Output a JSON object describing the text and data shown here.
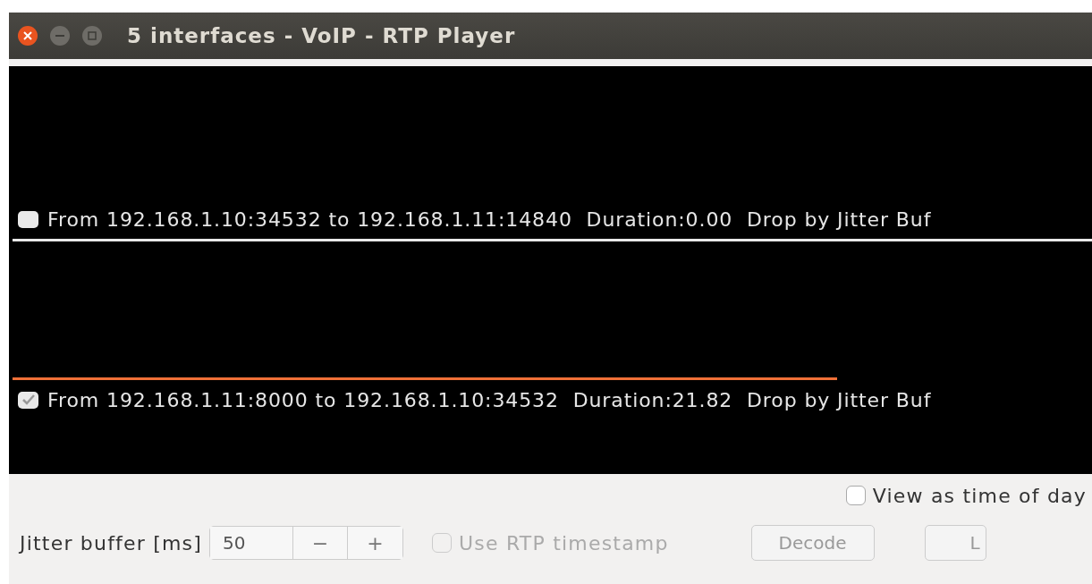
{
  "window": {
    "title": "5 interfaces - VoIP - RTP Player"
  },
  "streams": [
    {
      "checked": false,
      "label": "From 192.168.1.10:34532 to 192.168.1.11:14840",
      "duration": "Duration:0.00",
      "drop": "Drop by Jitter Buf",
      "color": "#e8e8e8",
      "level": 1
    },
    {
      "checked": true,
      "label": "From 192.168.1.11:8000 to 192.168.1.10:34532",
      "duration": "Duration:21.82",
      "drop": "Drop by Jitter Buf",
      "color": "#f07038",
      "level": 0.765
    }
  ],
  "view_time_of_day": {
    "label": "View as time of day",
    "checked": false
  },
  "jitter": {
    "label": "Jitter buffer [ms]",
    "value": "50",
    "minus": "−",
    "plus": "+"
  },
  "rtp_timestamp": {
    "label": "Use RTP timestamp",
    "checked": false,
    "disabled": true
  },
  "buttons": [
    {
      "label": "Decode",
      "disabled": true
    },
    {
      "label": "L",
      "disabled": true
    }
  ]
}
